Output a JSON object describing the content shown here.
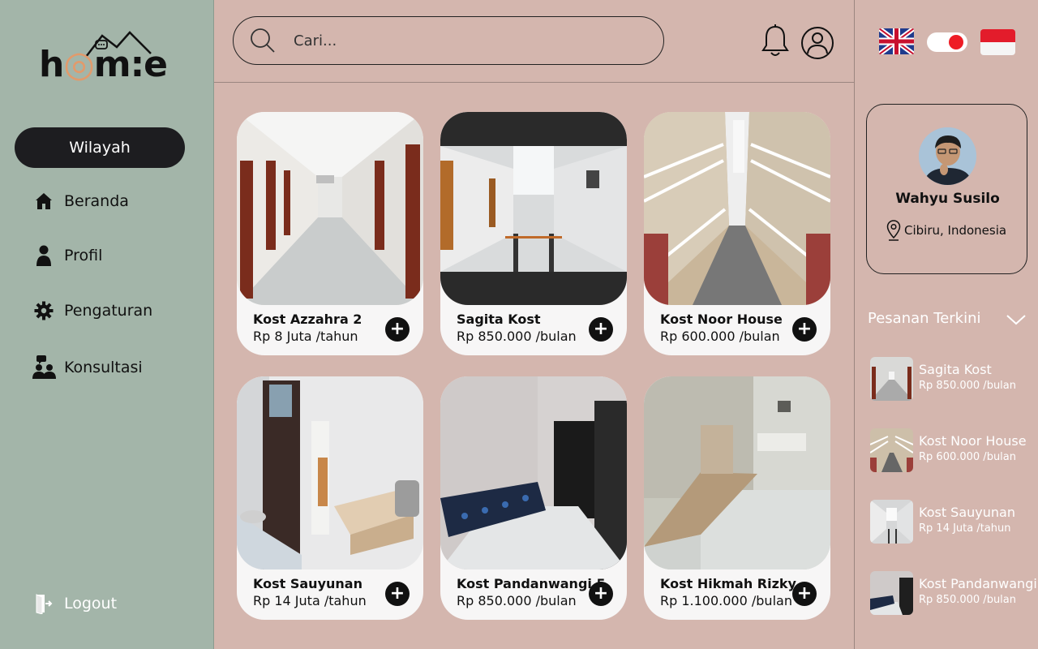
{
  "brand": {
    "logo_text_1": "h",
    "logo_text_2": "m:e"
  },
  "sidebar": {
    "primary_button": "Wilayah",
    "items": [
      {
        "label": "Beranda",
        "icon": "home-icon"
      },
      {
        "label": "Profil",
        "icon": "user-icon"
      },
      {
        "label": "Pengaturan",
        "icon": "gear-icon"
      },
      {
        "label": "Konsultasi",
        "icon": "consult-icon"
      }
    ],
    "logout_label": "Logout"
  },
  "search": {
    "placeholder": "Cari..."
  },
  "listings": [
    {
      "name": "Kost Azzahra 2",
      "price": "Rp 8 Juta /tahun"
    },
    {
      "name": "Sagita Kost",
      "price": "Rp 850.000 /bulan"
    },
    {
      "name": "Kost Noor House",
      "price": "Rp 600.000 /bulan"
    },
    {
      "name": "Kost Sauyunan",
      "price": "Rp 14 Juta /tahun"
    },
    {
      "name": "Kost Pandanwangi 5",
      "price": "Rp 850.000 /bulan"
    },
    {
      "name": "Kost Hikmah Rizky",
      "price": "Rp 1.100.000 /bulan"
    }
  ],
  "add_label": "+",
  "profile": {
    "name": "Wahyu Susilo",
    "location": "Cibiru, Indonesia"
  },
  "recent": {
    "title": "Pesanan Terkini",
    "items": [
      {
        "name": "Sagita Kost",
        "price": "Rp 850.000 /bulan"
      },
      {
        "name": "Kost Noor House",
        "price": "Rp 600.000 /bulan"
      },
      {
        "name": "Kost Sauyunan",
        "price": "Rp 14 Juta /tahun"
      },
      {
        "name": "Kost Pandanwangi",
        "price": "Rp 850.000 /bulan"
      }
    ]
  },
  "colors": {
    "sidebar": "#a3b5a9",
    "main": "#d4b6ae",
    "button": "#1d1d20",
    "toggle_knob": "#ee1c25"
  }
}
